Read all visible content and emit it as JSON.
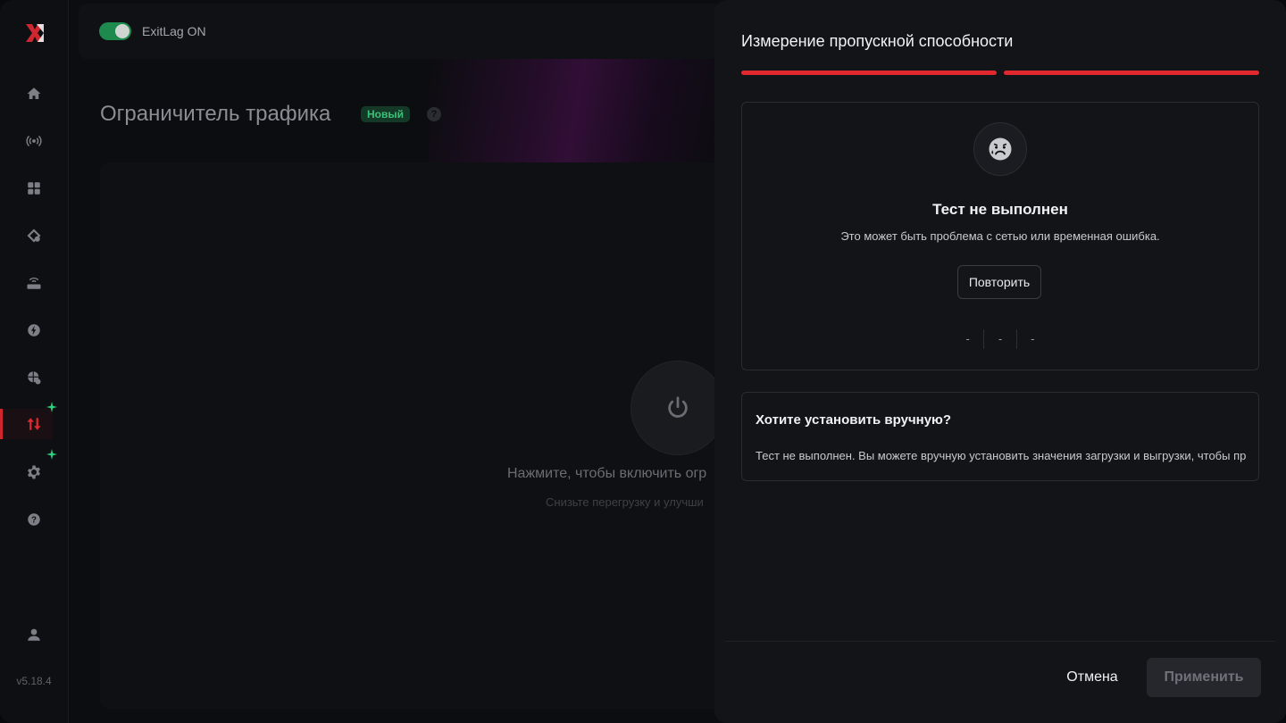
{
  "topbar": {
    "toggle_label": "ExitLag ON"
  },
  "sidebar": {
    "version": "v5.18.4",
    "items": [
      {
        "icon": "home-icon"
      },
      {
        "icon": "broadcast-icon"
      },
      {
        "icon": "grid-icon"
      },
      {
        "icon": "network-icon"
      },
      {
        "icon": "router-icon"
      },
      {
        "icon": "bolt-icon"
      },
      {
        "icon": "globe-icon"
      },
      {
        "icon": "traffic-arrows-icon",
        "active": true
      },
      {
        "icon": "gear-icon"
      },
      {
        "icon": "help-icon"
      },
      {
        "icon": "user-icon"
      }
    ]
  },
  "page": {
    "title": "Ограничитель трафика",
    "badge": "Новый",
    "help": "?",
    "cta": "Нажмите, чтобы включить огр",
    "sub": "Снизьте перегрузку и улучши"
  },
  "panel": {
    "title": "Измерение пропускной способности",
    "status_title": "Тест не выполнен",
    "status_sub": "Это может быть проблема с сетью или временная ошибка.",
    "retry_label": "Повторить",
    "metrics": [
      "-",
      "-",
      "-"
    ],
    "manual_title": "Хотите установить вручную?",
    "manual_text": "Тест не выполнен. Вы можете вручную установить значения загрузки и выгрузки, чтобы пр",
    "cancel_label": "Отмена",
    "apply_label": "Применить"
  },
  "colors": {
    "accent": "#e0282e",
    "success": "#1f8a4e",
    "panel_bg": "#131418"
  }
}
